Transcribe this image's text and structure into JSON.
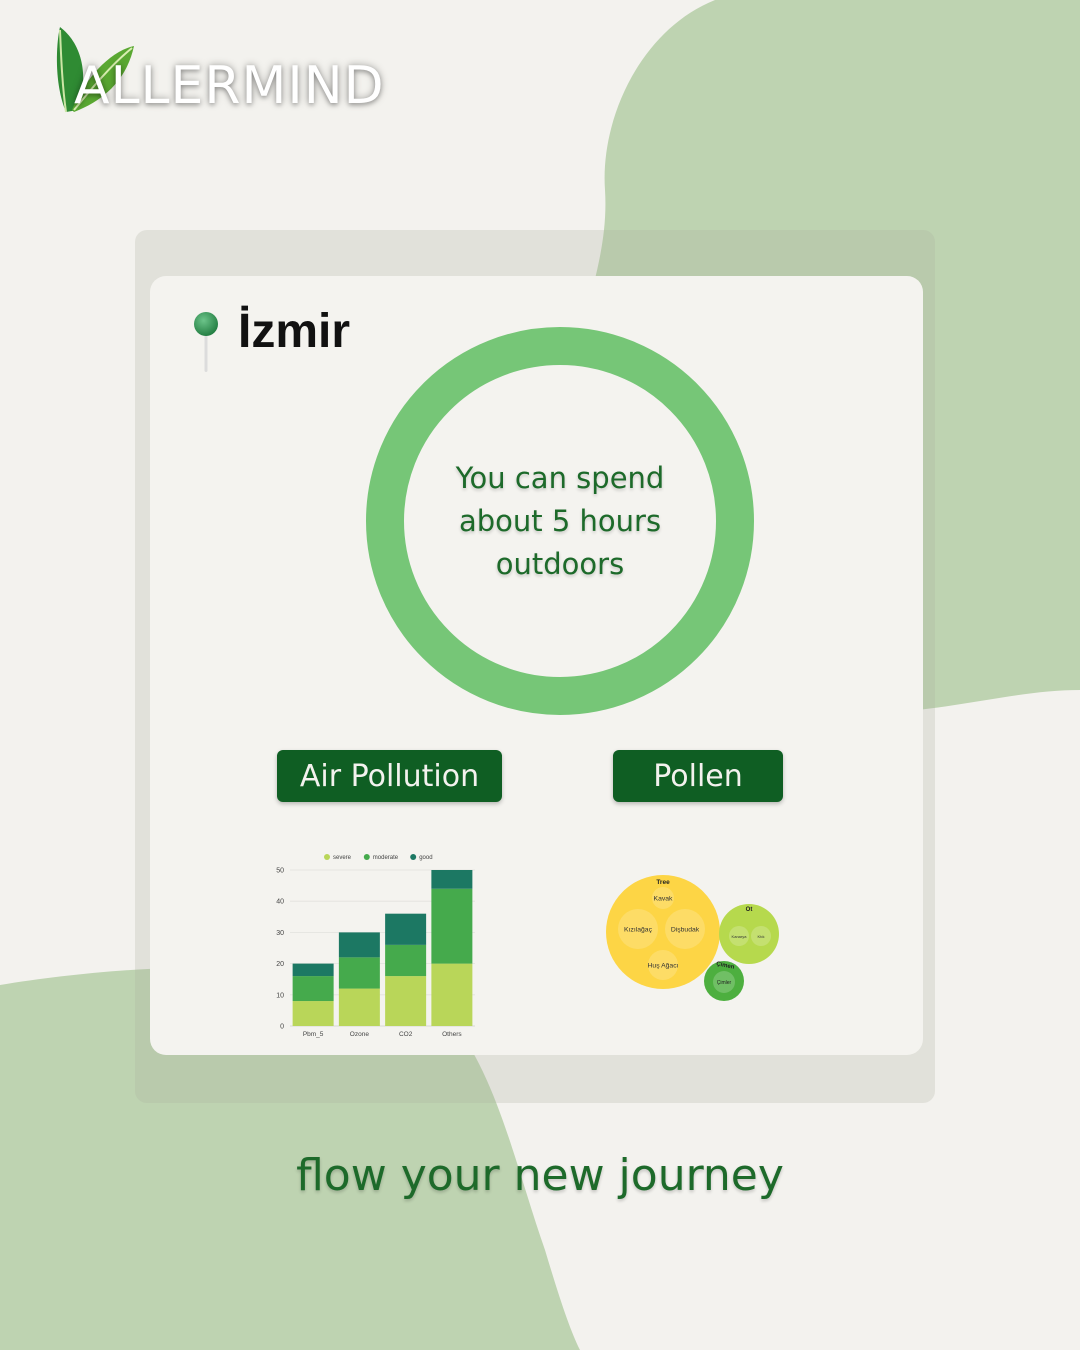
{
  "brand": {
    "name": "ALLERMIND",
    "leaf_icon": "leaf-icon"
  },
  "location": {
    "icon": "map-pin-icon",
    "city": "İzmir"
  },
  "outdoor": {
    "message": "You can spend about 5 hours outdoors",
    "hours": 5
  },
  "sections": {
    "air_pollution_label": "Air Pollution",
    "pollen_label": "Pollen"
  },
  "chart_data": [
    {
      "type": "bar",
      "stacked": true,
      "categories": [
        "Pbm_5",
        "Ozone",
        "CO2",
        "Others"
      ],
      "series": [
        {
          "name": "severe",
          "color": "#b9d659",
          "values": [
            8,
            12,
            16,
            20
          ]
        },
        {
          "name": "moderate",
          "color": "#45aa4c",
          "values": [
            8,
            10,
            10,
            24
          ]
        },
        {
          "name": "good",
          "color": "#1c7863",
          "values": [
            4,
            8,
            10,
            6
          ]
        }
      ],
      "ylim": [
        0,
        50
      ],
      "yticks": [
        0,
        10,
        20,
        30,
        40,
        50
      ],
      "legend": "top",
      "grid": true
    },
    {
      "type": "bubble",
      "groups": [
        {
          "name": "Tree",
          "color": "#fdd545",
          "children": [
            "Kavak",
            "Kızılağaç",
            "Dişbudak",
            "Huş Ağacı"
          ]
        },
        {
          "name": "Ot",
          "color": "#b6d94d",
          "children": [
            "Kanarya",
            "Ktık"
          ]
        },
        {
          "name": "Çimen",
          "color": "#4daf3f",
          "children": [
            "Çimler"
          ]
        }
      ]
    }
  ],
  "tagline": "flow your new journey",
  "colors": {
    "background": "#f3f2ee",
    "blob": "#bed3b1",
    "ring": "#76c677",
    "pill": "#0f5e23",
    "text_green": "#1d6a2a"
  }
}
